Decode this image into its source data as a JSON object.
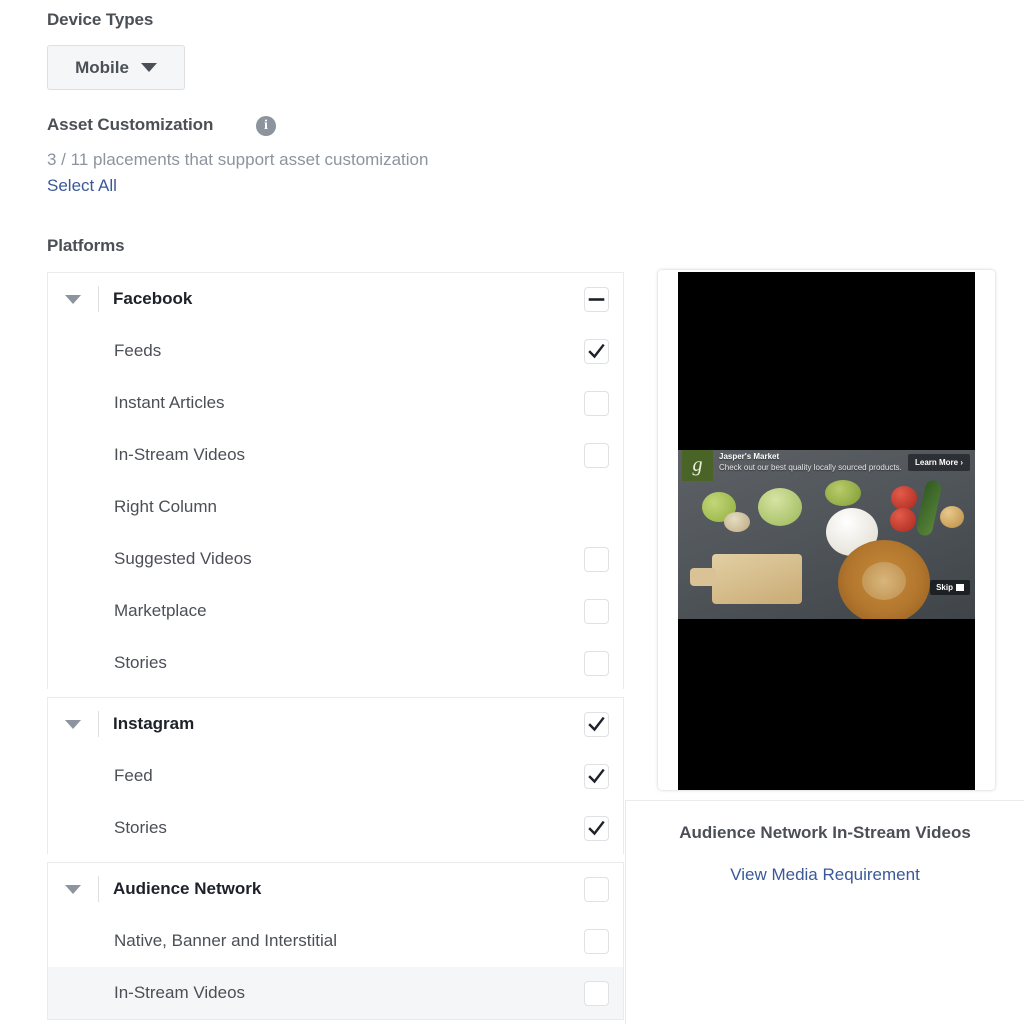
{
  "device_types": {
    "title": "Device Types",
    "selected": "Mobile"
  },
  "asset_customization": {
    "title": "Asset Customization",
    "info_icon": "info-icon",
    "count_text": "3 / 11 placements that support asset customization",
    "select_all": "Select All"
  },
  "platforms": {
    "title": "Platforms",
    "groups": [
      {
        "name": "Facebook",
        "state": "indeterminate",
        "items": [
          {
            "label": "Feeds",
            "state": "checked"
          },
          {
            "label": "Instant Articles",
            "state": "unchecked"
          },
          {
            "label": "In-Stream Videos",
            "state": "unchecked"
          },
          {
            "label": "Right Column",
            "state": "none"
          },
          {
            "label": "Suggested Videos",
            "state": "unchecked"
          },
          {
            "label": "Marketplace",
            "state": "unchecked"
          },
          {
            "label": "Stories",
            "state": "unchecked"
          }
        ]
      },
      {
        "name": "Instagram",
        "state": "checked",
        "items": [
          {
            "label": "Feed",
            "state": "checked"
          },
          {
            "label": "Stories",
            "state": "checked"
          }
        ]
      },
      {
        "name": "Audience Network",
        "state": "unchecked",
        "items": [
          {
            "label": "Native, Banner and Interstitial",
            "state": "unchecked"
          },
          {
            "label": "In-Stream Videos",
            "state": "unchecked",
            "highlighted": true
          }
        ]
      }
    ]
  },
  "preview": {
    "title": "Audience Network In-Stream Videos",
    "media_link": "View Media Requirement",
    "ad": {
      "brand": "Jasper's Market",
      "description": "Check out our best quality locally sourced products.",
      "cta": "Learn More ›",
      "skip": "Skip",
      "logo_glyph": "g"
    }
  },
  "colors": {
    "link": "#3b5998",
    "text": "#4b4f56",
    "muted": "#8d949e",
    "border": "#e9ebee",
    "row_highlight": "#f5f6f7"
  }
}
